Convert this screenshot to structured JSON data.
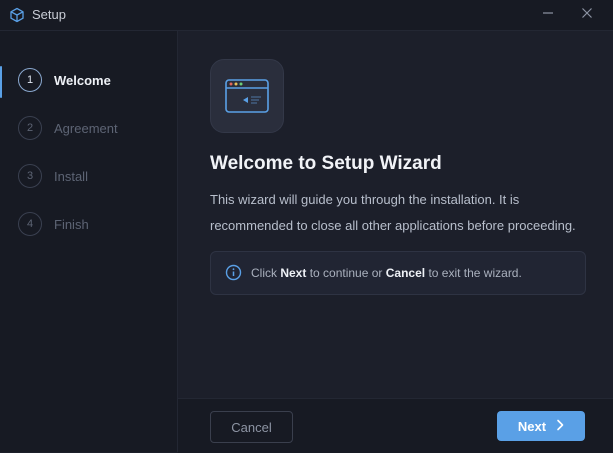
{
  "window": {
    "title": "Setup",
    "icon": "cube-icon",
    "minimize_icon": "minimize-icon",
    "close_icon": "close-icon"
  },
  "steps": [
    {
      "number": "1",
      "label": "Welcome",
      "active": true
    },
    {
      "number": "2",
      "label": "Agreement",
      "active": false
    },
    {
      "number": "3",
      "label": "Install",
      "active": false
    },
    {
      "number": "4",
      "label": "Finish",
      "active": false
    }
  ],
  "main": {
    "hero_icon": "browser-window-icon",
    "heading": "Welcome to Setup Wizard",
    "description": "This wizard will guide you through the installation. It is recommended to close all other applications before proceeding.",
    "info": {
      "icon": "info-icon",
      "prefix": "Click ",
      "next_word": "Next",
      "middle": " to continue or ",
      "cancel_word": "Cancel",
      "suffix": " to exit the wizard."
    }
  },
  "footer": {
    "cancel_label": "Cancel",
    "next_label": "Next",
    "next_icon": "chevron-right-icon"
  },
  "colors": {
    "accent": "#5aa0e6",
    "background": "#1c1f2a",
    "sidebar": "#171a23"
  }
}
